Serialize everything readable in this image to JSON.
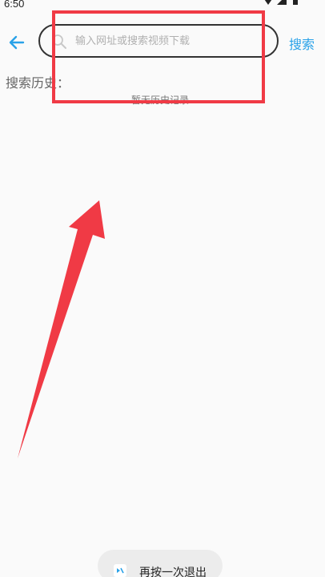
{
  "status_bar": {
    "time": "6:50",
    "icons": [
      "wifi-icon",
      "signal-icon",
      "battery-icon"
    ]
  },
  "toolbar": {
    "back_icon": "arrow-left-icon",
    "search_icon": "search-icon",
    "search_placeholder": "输入网址或搜索视频下载",
    "search_value": "",
    "search_button_label": "搜索"
  },
  "history": {
    "title": "搜索历史：",
    "empty_text": "暂无历史记录"
  },
  "toast": {
    "text": "再按一次退出"
  },
  "colors": {
    "accent": "#2aa2e8",
    "annotation": "#f03a45",
    "background": "#fafafa"
  }
}
